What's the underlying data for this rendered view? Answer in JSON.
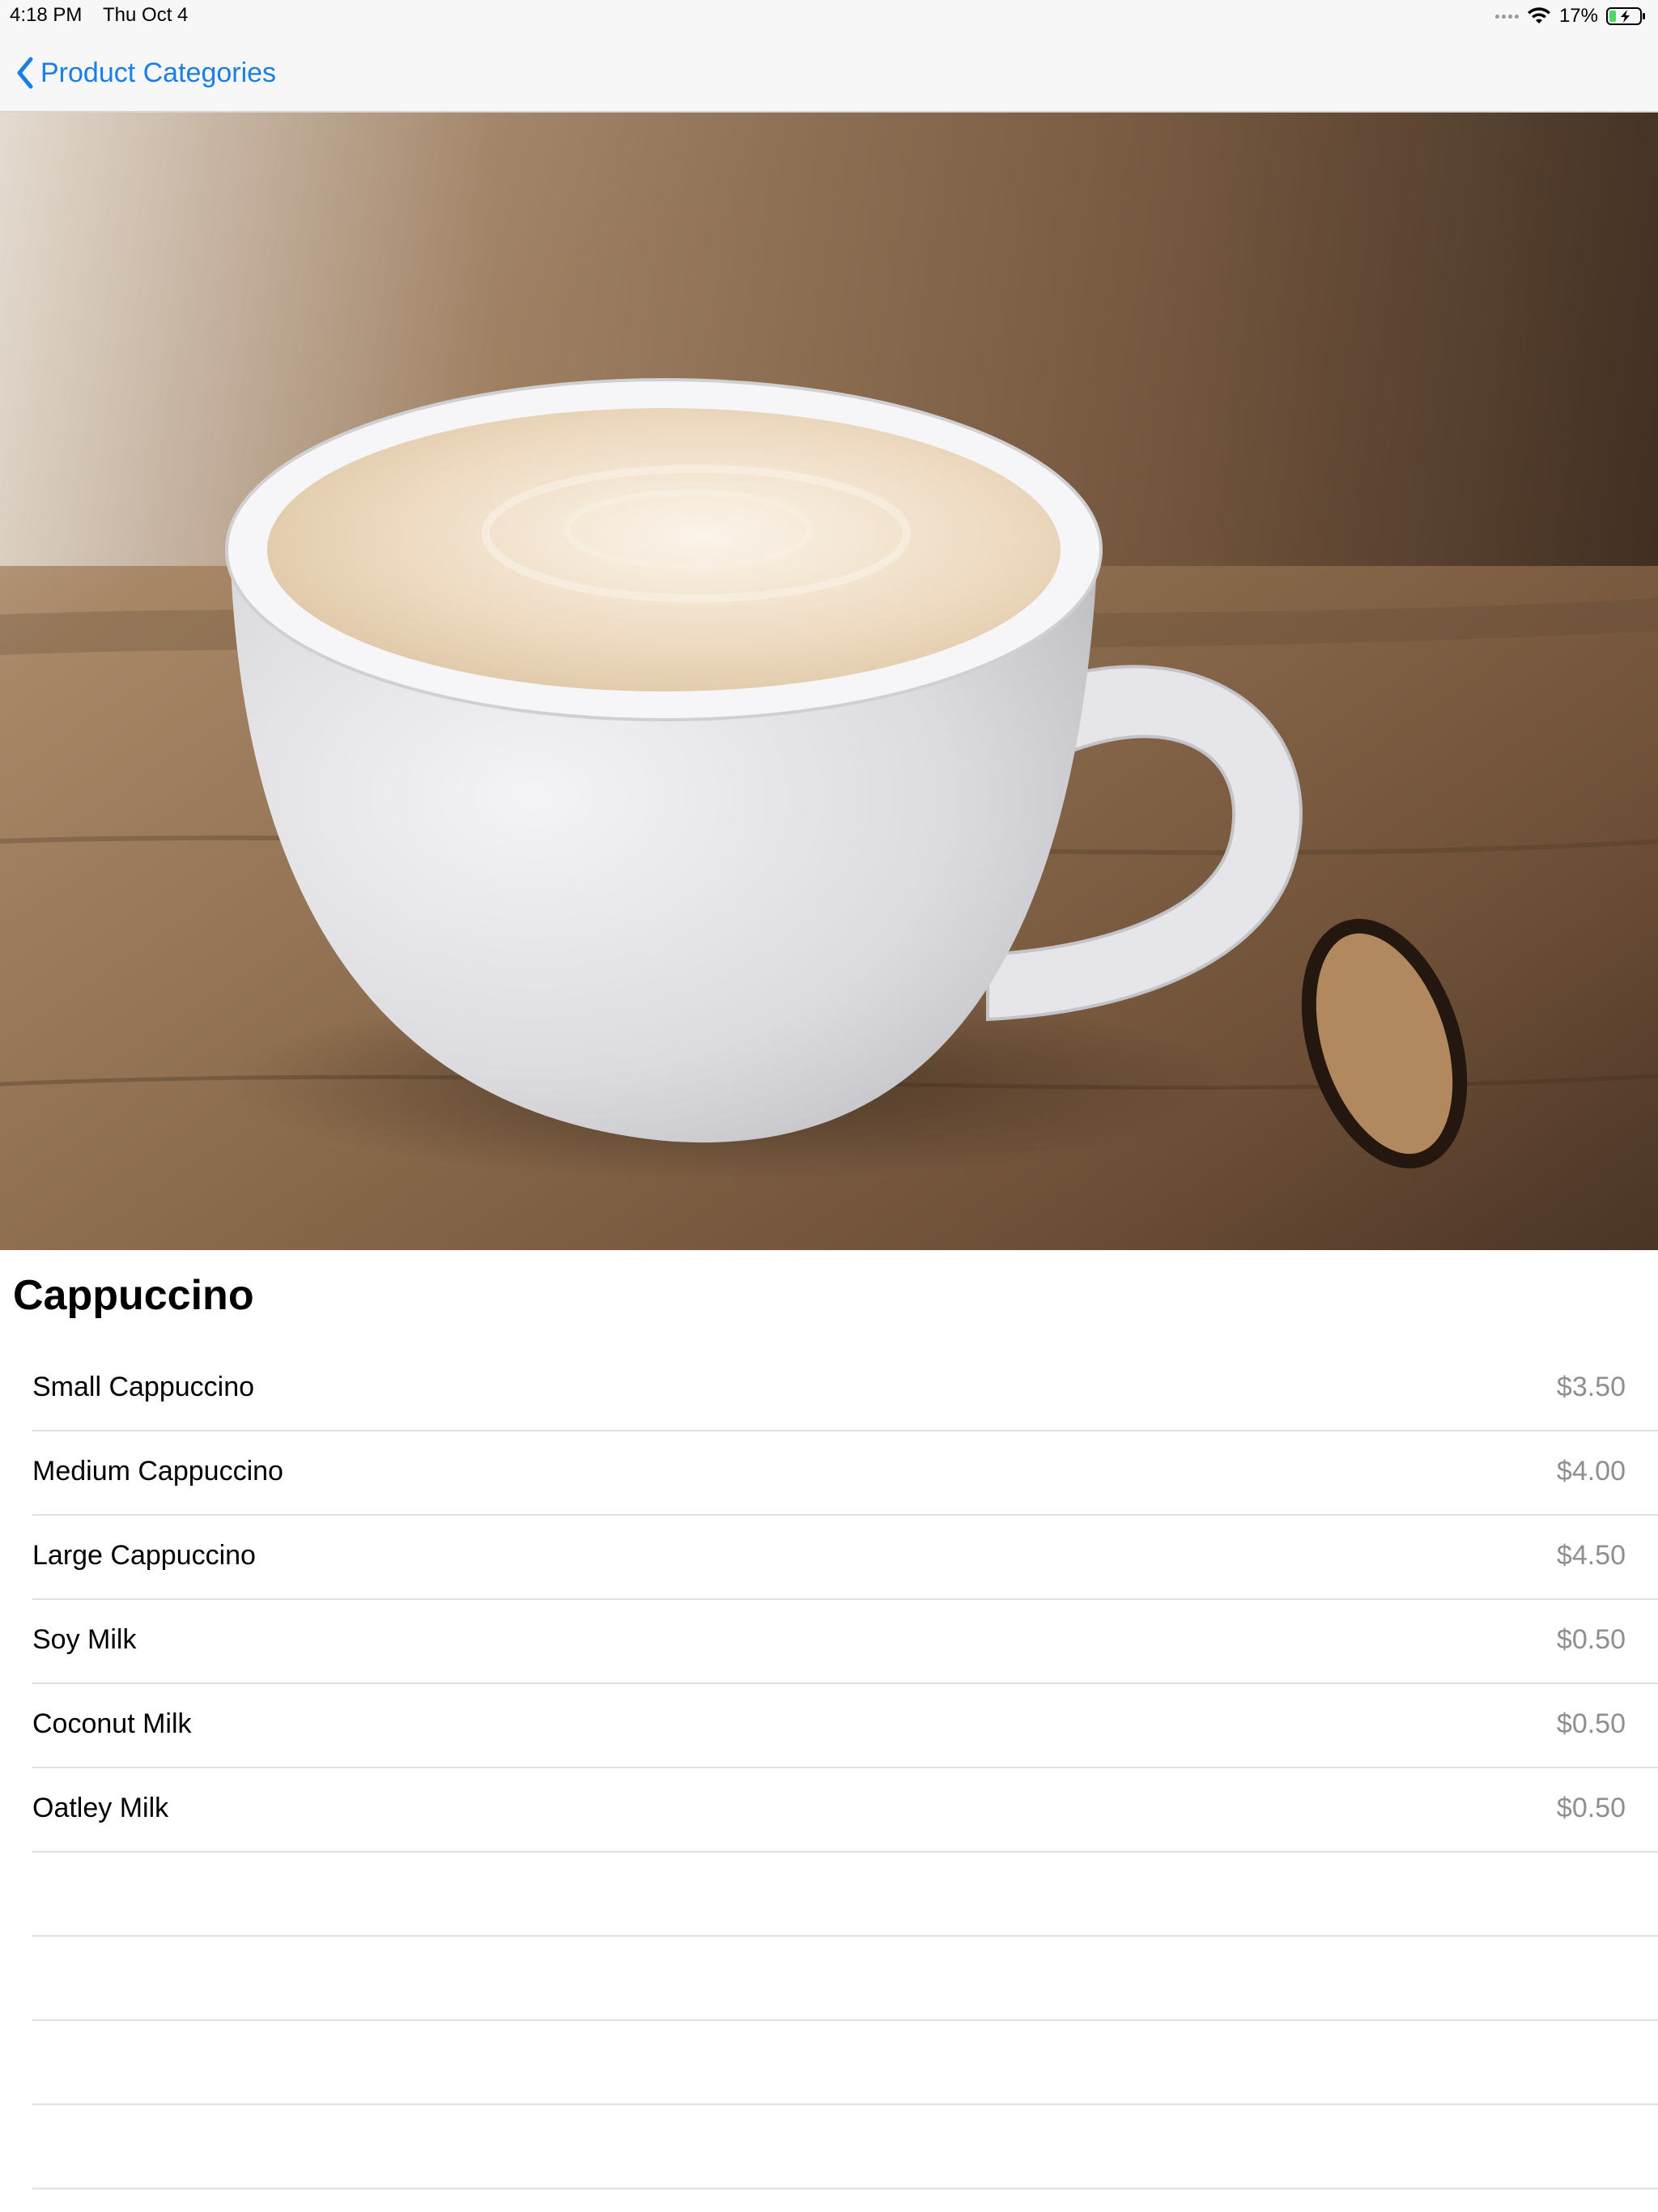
{
  "status_bar": {
    "time": "4:18 PM",
    "date": "Thu Oct 4",
    "battery_percent": "17%"
  },
  "nav": {
    "back_label": "Product Categories",
    "accent_color": "#1a7ee6"
  },
  "product": {
    "title": "Cappuccino",
    "image_icon": "coffee-cup-photo"
  },
  "items": [
    {
      "name": "Small Cappuccino",
      "price": "$3.50"
    },
    {
      "name": "Medium Cappuccino",
      "price": "$4.00"
    },
    {
      "name": "Large Cappuccino",
      "price": "$4.50"
    },
    {
      "name": "Soy Milk",
      "price": "$0.50"
    },
    {
      "name": "Coconut Milk",
      "price": "$0.50"
    },
    {
      "name": "Oatley Milk",
      "price": "$0.50"
    }
  ]
}
